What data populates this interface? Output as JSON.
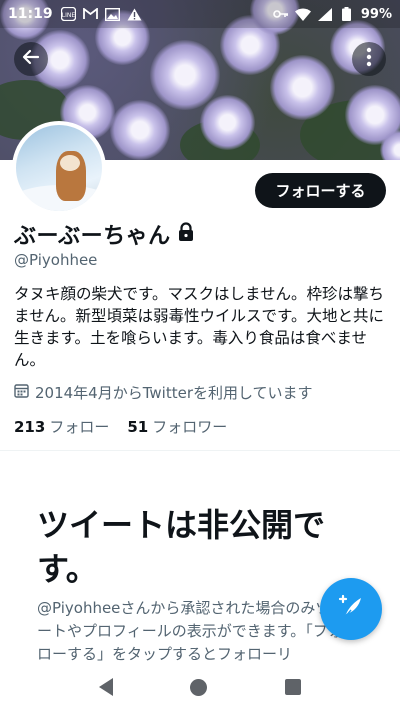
{
  "statusbar": {
    "time": "11:19",
    "battery": "99%",
    "left_icons": [
      "line-icon",
      "gmail-icon",
      "photo-icon",
      "warning-icon"
    ],
    "right_icons": [
      "key-icon",
      "wifi-icon",
      "signal-icon",
      "battery-icon"
    ]
  },
  "header": {
    "back_icon": "arrow-left-icon",
    "more_icon": "more-vertical-icon"
  },
  "profile": {
    "display_name": "ぶーぶーちゃん",
    "handle": "@Piyohhee",
    "lock_icon": "lock-icon",
    "follow_label": "フォローする",
    "bio": "タヌキ顔の柴犬です。マスクはしません。枠珍は撃ちません。新型頃菜は弱毒性ウイルスです。大地と共に生きます。土を喰らいます。毒入り食品は食べません。",
    "joined": "2014年4月からTwitterを利用しています",
    "following_count": "213",
    "following_label": "フォロー",
    "followers_count": "51",
    "followers_label": "フォロワー"
  },
  "protected": {
    "title": "ツイートは非公開です。",
    "description": "@Piyohheeさんから承認された場合のみツイートやプロフィールの表示ができます。「フォローする」をタップするとフォローリ"
  },
  "fab": {
    "icon": "compose-tweet-icon"
  },
  "colors": {
    "accent": "#1d9bf0",
    "text": "#0f1419",
    "secondary": "#536471"
  }
}
